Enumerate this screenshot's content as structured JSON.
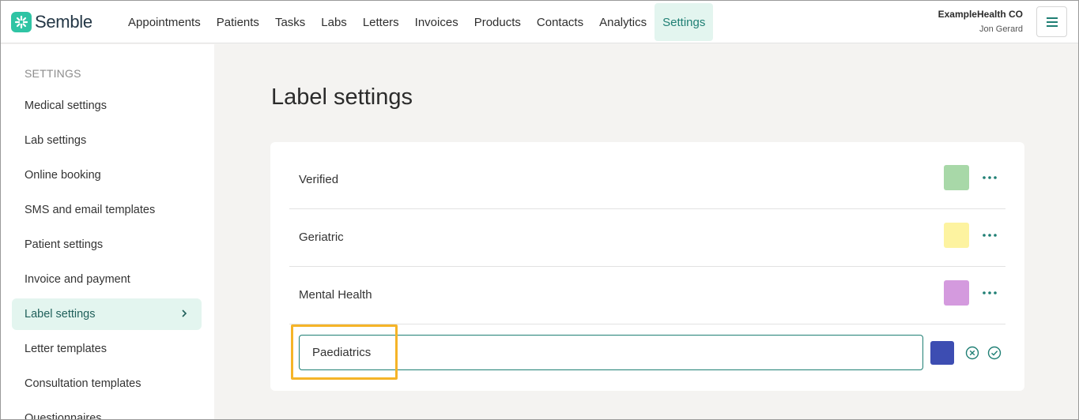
{
  "app": {
    "brand": "Semble",
    "org_name": "ExampleHealth CO",
    "user_name": "Jon Gerard",
    "accent_color": "#1f7f74",
    "logo_color": "#2fc4a4"
  },
  "nav": {
    "items": [
      {
        "label": "Appointments"
      },
      {
        "label": "Patients"
      },
      {
        "label": "Tasks"
      },
      {
        "label": "Labs"
      },
      {
        "label": "Letters"
      },
      {
        "label": "Invoices"
      },
      {
        "label": "Products"
      },
      {
        "label": "Contacts"
      },
      {
        "label": "Analytics"
      },
      {
        "label": "Settings",
        "active": true
      }
    ],
    "menu_icon": "hamburger-icon"
  },
  "sidebar": {
    "heading": "SETTINGS",
    "items": [
      {
        "label": "Medical settings"
      },
      {
        "label": "Lab settings"
      },
      {
        "label": "Online booking"
      },
      {
        "label": "SMS and email templates"
      },
      {
        "label": "Patient settings"
      },
      {
        "label": "Invoice and payment"
      },
      {
        "label": "Label settings",
        "active": true
      },
      {
        "label": "Letter templates"
      },
      {
        "label": "Consultation templates"
      },
      {
        "label": "Questionnaires"
      }
    ]
  },
  "main": {
    "title": "Label settings",
    "labels": [
      {
        "name": "Verified",
        "color": "#a8d8a8",
        "menu_icon": "more-horizontal-icon"
      },
      {
        "name": "Geriatric",
        "color": "#fdf3a0",
        "menu_icon": "more-horizontal-icon"
      },
      {
        "name": "Mental Health",
        "color": "#d49ade",
        "menu_icon": "more-horizontal-icon"
      }
    ],
    "new_label": {
      "value": "Paediatrics",
      "color": "#3d4db2",
      "cancel_icon": "cancel-circle-icon",
      "confirm_icon": "check-circle-icon",
      "highlight_color": "#f5b428"
    }
  }
}
